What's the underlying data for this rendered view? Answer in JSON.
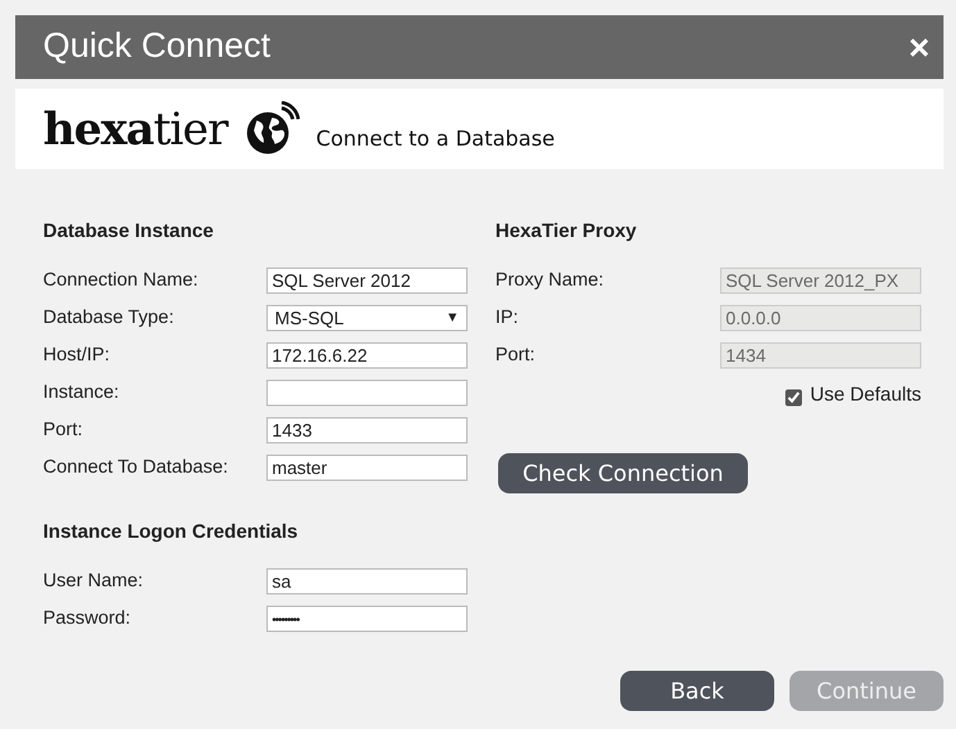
{
  "window": {
    "title": "Quick Connect",
    "close": "×"
  },
  "header": {
    "logo": "**hexa**tier",
    "subtitle": "Connect to a Database"
  },
  "database_instance": {
    "heading": "Database Instance",
    "fields": [
      {
        "label": "Connection Name:",
        "kind": "text",
        "value": "SQL Server 2012"
      },
      {
        "label": "Database Type:",
        "kind": "select",
        "value": "MS-SQL",
        "caret": "▼"
      },
      {
        "label": "Host/IP:",
        "kind": "text",
        "value": "172.16.6.22"
      },
      {
        "label": "Instance:",
        "kind": "text"
      },
      {
        "label": "Port:",
        "kind": "text",
        "value": "1433"
      },
      {
        "label": "Connect To Database:",
        "kind": "text",
        "value": "master"
      }
    ]
  },
  "credentials": {
    "heading": "Instance Logon Credentials",
    "fields": [
      {
        "label": "User Name:",
        "kind": "text",
        "value": "sa"
      },
      {
        "label": "Password:",
        "kind": "password",
        "value": "•••••••••"
      }
    ]
  },
  "proxy": {
    "heading": "HexaTier Proxy",
    "fields": [
      {
        "label": "Proxy Name:",
        "kind": "text",
        "value": "SQL Server 2012_PX",
        "disabled": true
      },
      {
        "label": "IP:",
        "kind": "text",
        "value": "0.0.0.0",
        "disabled": true
      },
      {
        "label": "Port:",
        "kind": "text",
        "value": "1434",
        "disabled": true
      }
    ],
    "use_defaults": {
      "label": "Use Defaults",
      "checked": true
    },
    "check_button": "Check Connection"
  },
  "buttons": [
    {
      "label": "Back",
      "disabled": false
    },
    {
      "label": "Continue",
      "disabled": true
    }
  ]
}
